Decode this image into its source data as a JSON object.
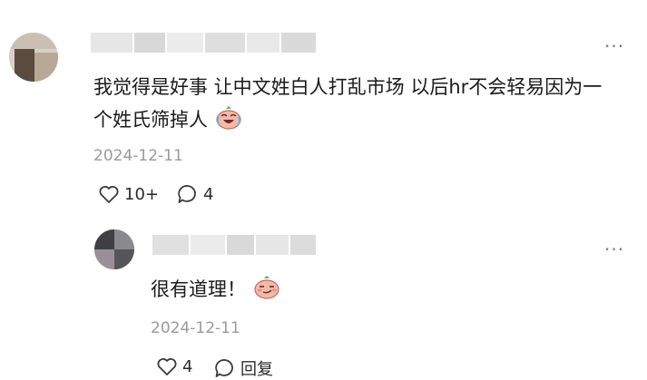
{
  "comment": {
    "text": "我觉得是好事 让中文姓白人打乱市场 以后hr不会轻易因为一个姓氏筛掉人",
    "emoji": "crying-laughing-face",
    "date": "2024-12-11",
    "like_count": "10+",
    "reply_count": "4"
  },
  "reply": {
    "text": "很有道理！",
    "emoji": "smirk-face",
    "date": "2024-12-11",
    "like_count": "4",
    "reply_label": "回复"
  },
  "colors": {
    "meta_text": "#9a9a9a",
    "icon": "#3a3a3a"
  }
}
